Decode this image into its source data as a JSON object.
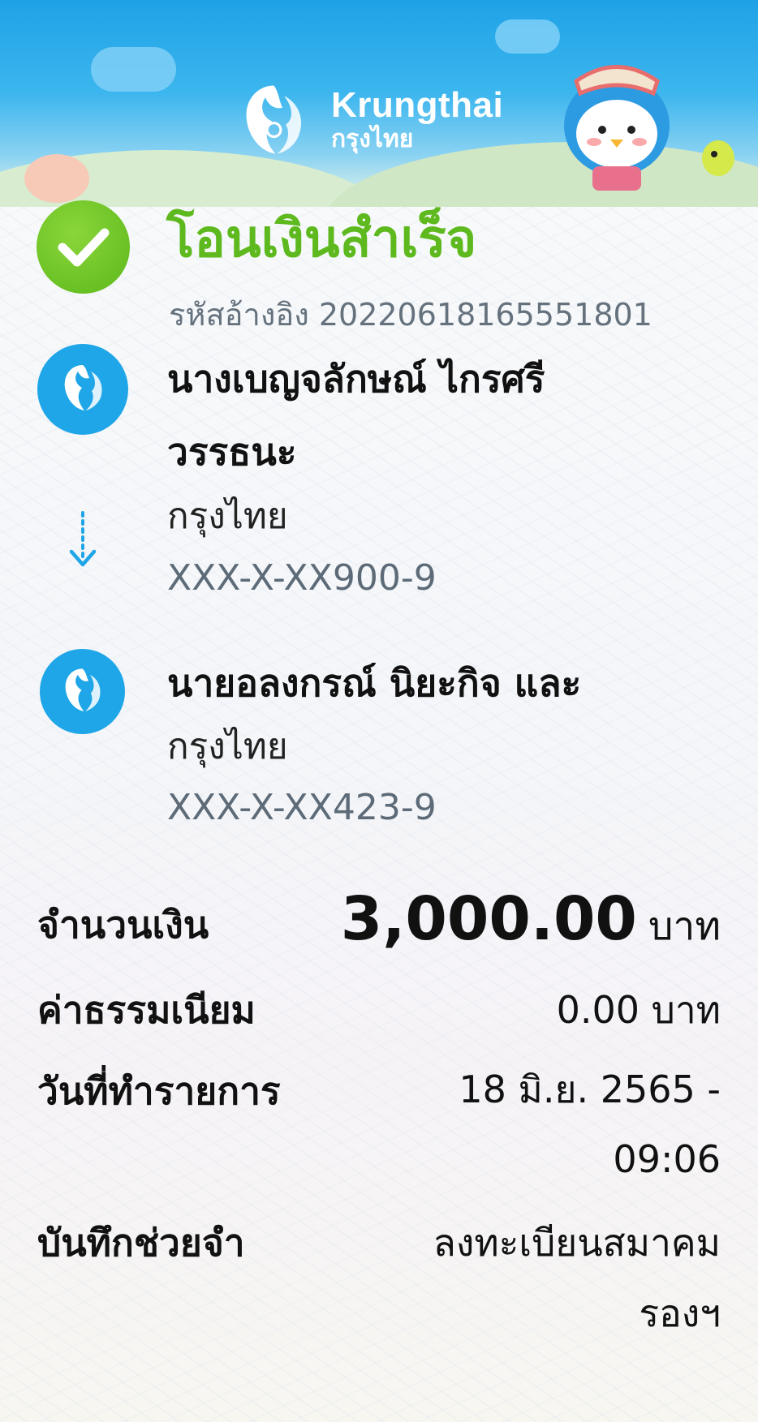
{
  "brand": {
    "name_en": "Krungthai",
    "name_th": "กรุงไทย"
  },
  "status": {
    "title": "โอนเงินสำเร็จ",
    "reference_label": "รหัสอ้างอิง",
    "reference_number": "20220618165551801"
  },
  "sender": {
    "name_line1": "นางเบญจลักษณ์ ไกรศรี",
    "name_line2": "วรรธนะ",
    "bank": "กรุงไทย",
    "account": "XXX-X-XX900-9"
  },
  "receiver": {
    "name": "นายอลงกรณ์ นิยะกิจ และ",
    "bank": "กรุงไทย",
    "account": "XXX-X-XX423-9"
  },
  "details": {
    "amount_label": "จำนวนเงิน",
    "amount_value": "3,000.00",
    "amount_unit": "บาท",
    "fee_label": "ค่าธรรมเนียม",
    "fee_value": "0.00 บาท",
    "date_label": "วันที่ทำรายการ",
    "date_value_line1": "18 มิ.ย. 2565 -",
    "date_value_line2": "09:06",
    "memo_label": "บันทึกช่วยจำ",
    "memo_value_line1": "ลงทะเบียนสมาคม",
    "memo_value_line2": "รองฯ"
  },
  "colors": {
    "success_green": "#5db91d",
    "bank_blue": "#1ea6e8",
    "secondary_text": "#5d6b78"
  },
  "icons": [
    "krungthai-logo-icon",
    "check-icon",
    "transfer-arrow-icon",
    "bank-logo-icon",
    "mascot-illustration"
  ]
}
